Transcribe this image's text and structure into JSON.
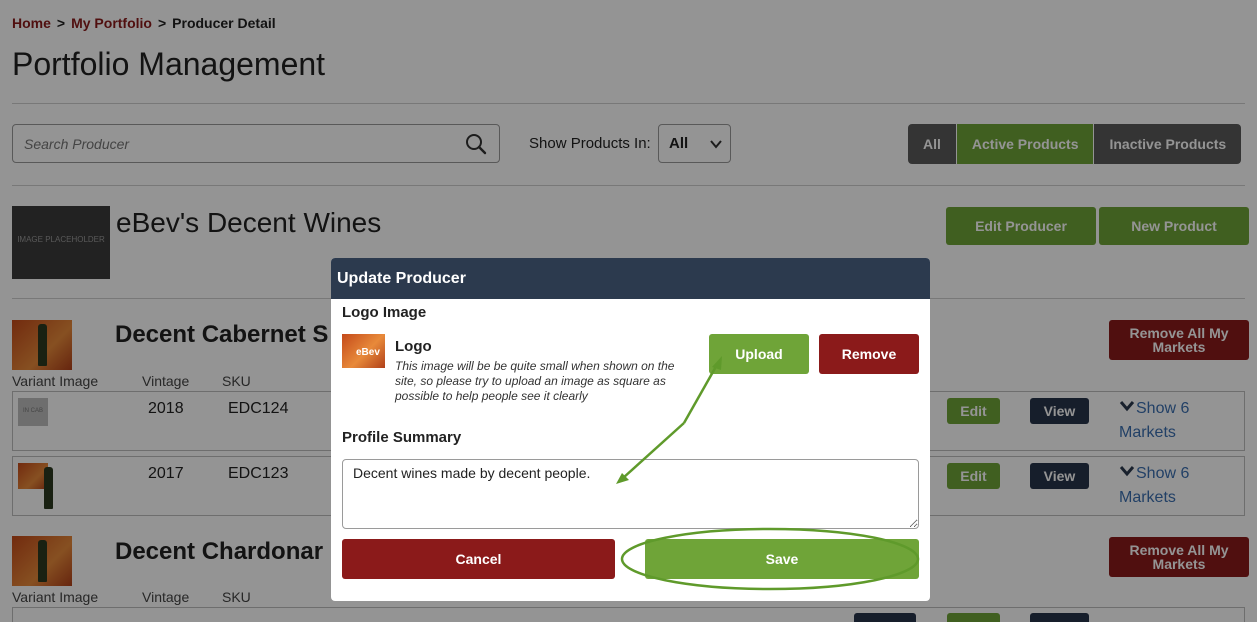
{
  "breadcrumb": {
    "home": "Home",
    "portfolio": "My Portfolio",
    "current": "Producer Detail",
    "sep": ">"
  },
  "page": {
    "title": "Portfolio Management"
  },
  "search": {
    "placeholder": "Search Producer"
  },
  "filter": {
    "label": "Show Products In:",
    "selected": "All"
  },
  "segments": {
    "all": "All",
    "active": "Active Products",
    "inactive": "Inactive Products"
  },
  "producer": {
    "image_text": "IMAGE PLACEHOLDER",
    "name": "eBev's Decent Wines",
    "edit_button": "Edit Producer",
    "new_button": "New Product"
  },
  "products": [
    {
      "name": "Decent Cabernet S",
      "remove_button": "Remove All My Markets",
      "headers": {
        "image": "Variant Image",
        "vintage": "Vintage",
        "sku": "SKU"
      },
      "rows": [
        {
          "vintage": "2018",
          "sku": "EDC124",
          "thumb_text": "IN CAB",
          "edit": "Edit",
          "view": "View",
          "markets_1": "Show 6",
          "markets_2": "Markets"
        },
        {
          "vintage": "2017",
          "sku": "EDC123",
          "edit": "Edit",
          "view": "View",
          "markets_1": "Show 6",
          "markets_2": "Markets"
        }
      ]
    },
    {
      "name": "Decent Chardonar",
      "remove_button": "Remove All My Markets",
      "headers": {
        "image": "Variant Image",
        "vintage": "Vintage",
        "sku": "SKU"
      }
    }
  ],
  "modal": {
    "title": "Update Producer",
    "logo_section": "Logo Image",
    "logo_brand": "eBev",
    "logo_title": "Logo",
    "logo_note": "This image will be be quite small when shown on the site, so please try to upload an image as square as possible to help people see it clearly",
    "upload": "Upload",
    "remove": "Remove",
    "summary_label": "Profile Summary",
    "summary_value": "Decent wines made by decent people.",
    "cancel": "Cancel",
    "save": "Save"
  },
  "colors": {
    "green": "#6fa438",
    "maroon": "#8b1a1a",
    "navy": "#2c3a4e",
    "annotation": "#5f9a2b"
  }
}
